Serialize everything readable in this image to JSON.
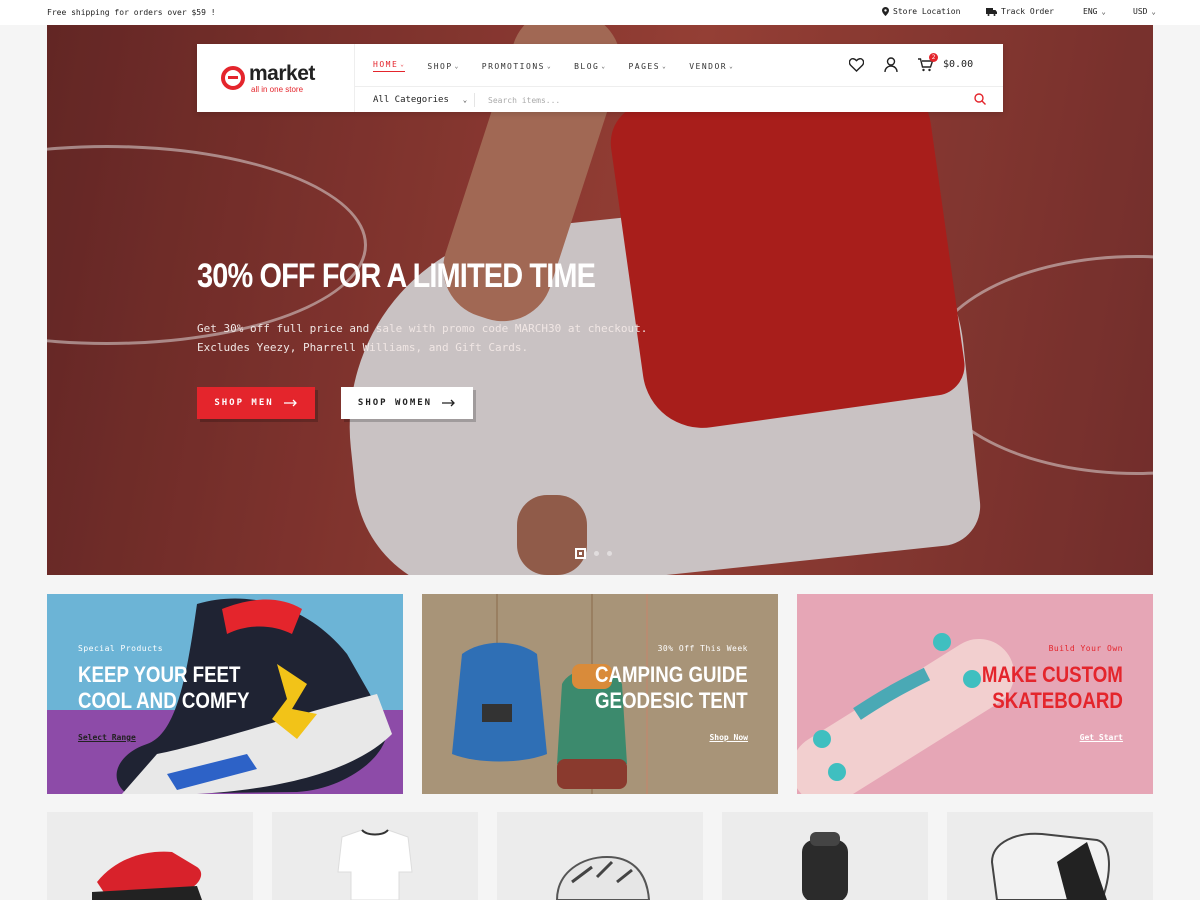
{
  "topbar": {
    "promo": "Free shipping for orders over $59 !",
    "store_location": "Store Location",
    "track_order": "Track Order",
    "language": "ENG",
    "currency": "USD"
  },
  "header": {
    "logo_name": "market",
    "logo_tagline": "all in one store",
    "nav": [
      "HOME",
      "SHOP",
      "PROMOTIONS",
      "BLOG",
      "PAGES",
      "VENDOR"
    ],
    "category_select": "All Categories",
    "search_placeholder": "Search items...",
    "cart_count": "2",
    "cart_total": "$0.00"
  },
  "hero": {
    "title": "30% OFF FOR A LIMITED TIME",
    "subtitle_line1": "Get 30% off full price and sale with promo code MARCH30 at checkout.",
    "subtitle_line2": "Excludes Yeezy, Pharrell Williams, and Gift Cards.",
    "btn_men": "SHOP MEN",
    "btn_women": "SHOP WOMEN",
    "slides": 3,
    "active_slide": 1
  },
  "banners": [
    {
      "kicker": "Special Products",
      "title_line1": "KEEP YOUR FEET",
      "title_line2": "COOL AND COMFY",
      "link": "Select Range"
    },
    {
      "kicker": "30% Off This Week",
      "title_line1": "CAMPING GUIDE",
      "title_line2": "GEODESIC TENT",
      "link": "Shop Now"
    },
    {
      "kicker": "Build Your Own",
      "title_line1": "MAKE CUSTOM",
      "title_line2": "SKATEBOARD",
      "link": "Get Start"
    }
  ],
  "colors": {
    "accent": "#e4252c",
    "banner3_text": "#e4252c"
  },
  "products": [
    "sneaker",
    "t-shirt",
    "bike-helmet",
    "backpack",
    "boxing-glove"
  ]
}
